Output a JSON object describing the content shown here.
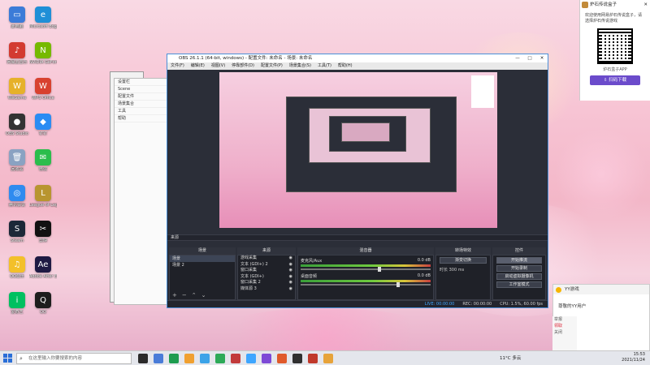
{
  "desktop": {
    "icons": [
      {
        "label": "此电脑",
        "color": "#3b7bd8",
        "glyph": "▭"
      },
      {
        "label": "网易云音乐",
        "color": "#d33a31",
        "glyph": "♪"
      },
      {
        "label": "WeGame",
        "color": "#e6b12a",
        "glyph": "W"
      },
      {
        "label": "OBS Studio",
        "color": "#333333",
        "glyph": "●"
      },
      {
        "label": "回收站",
        "color": "#8aa2c2",
        "glyph": "🗑"
      },
      {
        "label": "腾讯会议",
        "color": "#2f8bef",
        "glyph": "◎"
      },
      {
        "label": "Steam",
        "color": "#1b2838",
        "glyph": "S"
      },
      {
        "label": "QQ音乐",
        "color": "#f3c02a",
        "glyph": "♫"
      },
      {
        "label": "爱奇艺",
        "color": "#00c060",
        "glyph": "i"
      },
      {
        "label": "Microsoft Edge",
        "color": "#1f8fd7",
        "glyph": "e"
      },
      {
        "label": "NVIDIA GeForce",
        "color": "#76b900",
        "glyph": "N"
      },
      {
        "label": "WPS Office",
        "color": "#d8412f",
        "glyph": "W"
      },
      {
        "label": "钉钉",
        "color": "#2a8cf3",
        "glyph": "◆"
      },
      {
        "label": "微信",
        "color": "#2bbd4c",
        "glyph": "✉"
      },
      {
        "label": "League of Legends",
        "color": "#b8952f",
        "glyph": "L"
      },
      {
        "label": "剪映",
        "color": "#111111",
        "glyph": "✂"
      },
      {
        "label": "Adobe After Effects 2020",
        "color": "#1e1a43",
        "glyph": "Ae"
      },
      {
        "label": "QQ",
        "color": "#1d1d1d",
        "glyph": "Q"
      }
    ]
  },
  "background_window": {
    "rows": [
      "设置栏",
      "Scene",
      "配置文件",
      "场景集合",
      "工具",
      "帮助"
    ]
  },
  "obs": {
    "title": "OBS 26.1.1 (64-bit, windows) - 配置文件: 未命名 - 场景: 未命名",
    "window_controls": [
      "—",
      "□",
      "✕"
    ],
    "menu": [
      "文件(F)",
      "编辑(E)",
      "视图(V)",
      "停靠部件(D)",
      "配置文件(P)",
      "场景集合(S)",
      "工具(T)",
      "帮助(H)"
    ],
    "status_line": "来源",
    "dock_headers": {
      "scenes": "场景",
      "sources": "来源",
      "mixer": "混音器",
      "transitions": "转场特效",
      "controls": "控件"
    },
    "scenes": [
      "场景",
      "场景 2"
    ],
    "sources": [
      "游戏采集",
      "文本 (GDI+) 2",
      "窗口采集",
      "文本 (GDI+)",
      "窗口采集 2",
      "媒体源 3"
    ],
    "mixer": [
      {
        "name": "麦克风/Aux",
        "db": "0.0 dB"
      },
      {
        "name": "桌面音频",
        "db": "0.0 dB"
      }
    ],
    "transitions": {
      "selected": "渐变切换",
      "duration_label": "时长",
      "duration": "300 ms"
    },
    "controls": [
      "开始推流",
      "开始录制",
      "启动虚拟摄像机",
      "工作室模式",
      "设置",
      "退出"
    ],
    "footer": {
      "live": "LIVE: 00:00:00",
      "rec": "REC: 00:00:00",
      "cpu": "CPU: 1.5%, 60.00 fps"
    }
  },
  "popup": {
    "title": "炉石传说盒子",
    "close": "✕",
    "text": "欢迎使用网易炉石传说盒子，请选择炉石传说游戏",
    "qr_caption": "炉石盒子APP",
    "button": "⇩ 扫码下载"
  },
  "notification": {
    "title": "YY游戏",
    "body": "尊敬的YY用户",
    "side": [
      "举报",
      "领取",
      "关闭"
    ]
  },
  "taskbar": {
    "search_placeholder": "在这里输入你要搜索的内容",
    "weather": "11°C 多云",
    "time": "15:53",
    "date": "2021/11/24",
    "app_colors": [
      "#2b2b2b",
      "#4a7cd8",
      "#1e9c4f",
      "#f0a030",
      "#3ba3e8",
      "#2daa58",
      "#c23b3b",
      "#3ea6ff",
      "#7d4ad6",
      "#e05a2b",
      "#303030",
      "#c0392b",
      "#e7a33a"
    ]
  }
}
